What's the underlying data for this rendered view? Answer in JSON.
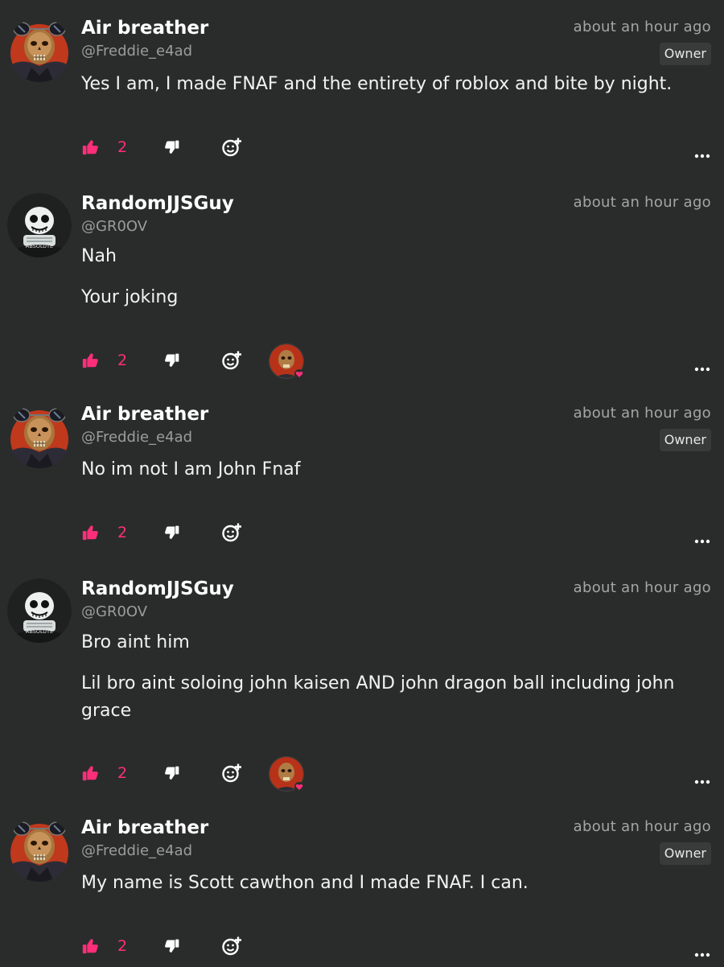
{
  "theme": {
    "bg": "#2a2c2b",
    "accent": "#ff2e7a"
  },
  "comments": [
    {
      "author": "Air breather",
      "handle": "@Freddie_e4ad",
      "time": "about an hour ago",
      "badge": "Owner",
      "avatar": "skull-sunglasses-avatar",
      "paragraphs": [
        "Yes I am, I made FNAF and the entirety of roblox and bite by night."
      ],
      "likes": "2",
      "reactor": null
    },
    {
      "author": "RandomJJSGuy",
      "handle": "@GR0OV",
      "time": "about an hour ago",
      "badge": null,
      "avatar": "skeleton-absolute-avatar",
      "avatar_text": "ABSOLUTE",
      "paragraphs": [
        "Nah",
        "Your joking"
      ],
      "likes": "2",
      "reactor": "skull-reactor-avatar"
    },
    {
      "author": "Air breather",
      "handle": "@Freddie_e4ad",
      "time": "about an hour ago",
      "badge": "Owner",
      "avatar": "skull-sunglasses-avatar",
      "paragraphs": [
        "No im not I am John Fnaf"
      ],
      "likes": "2",
      "reactor": null
    },
    {
      "author": "RandomJJSGuy",
      "handle": "@GR0OV",
      "time": "about an hour ago",
      "badge": null,
      "avatar": "skeleton-absolute-avatar",
      "avatar_text": "ABSOLUTE",
      "paragraphs": [
        "Bro aint him",
        "Lil bro aint soloing john kaisen AND john dragon ball including john grace"
      ],
      "likes": "2",
      "reactor": "skull-reactor-avatar"
    },
    {
      "author": "Air breather",
      "handle": "@Freddie_e4ad",
      "time": "about an hour ago",
      "badge": "Owner",
      "avatar": "skull-sunglasses-avatar",
      "paragraphs": [
        "My name is Scott cawthon and I made FNAF. I can."
      ],
      "likes": "2",
      "reactor": null
    }
  ]
}
